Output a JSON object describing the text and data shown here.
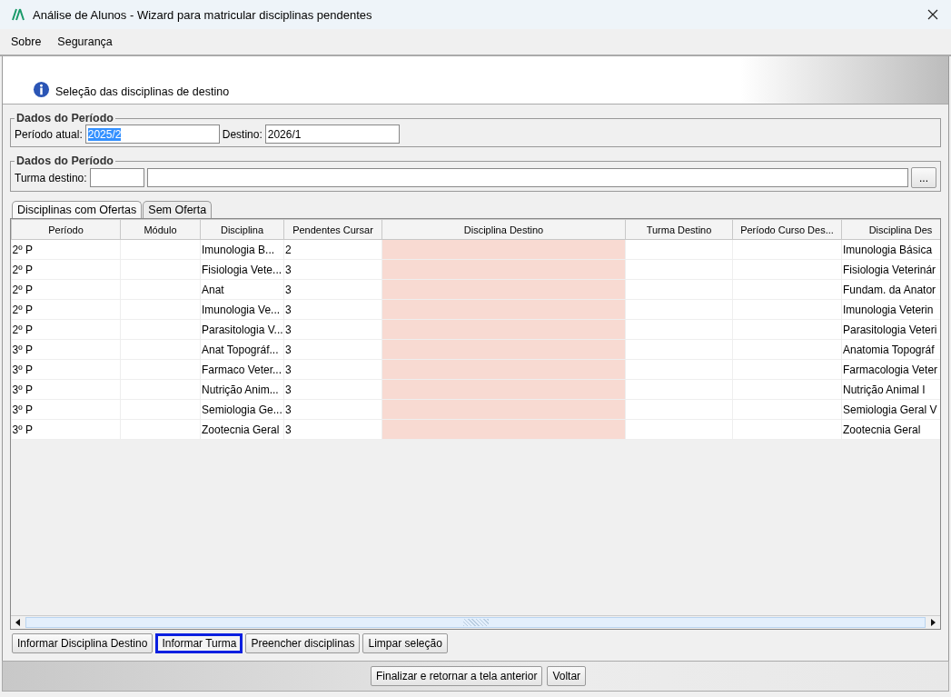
{
  "window": {
    "title": "Análise de Alunos - Wizard para matricular disciplinas pendentes"
  },
  "menu": [
    {
      "label": "Sobre"
    },
    {
      "label": "Segurança"
    }
  ],
  "header": {
    "text": "Seleção das disciplinas de destino"
  },
  "period_group": {
    "legend": "Dados do Período",
    "current_label": "Período atual:",
    "current_value": "2025/2",
    "current_selected": true,
    "target_label": "Destino:",
    "target_value": "2026/1"
  },
  "class_group": {
    "legend": "Dados do Período",
    "label": "Turma destino:",
    "browse": "..."
  },
  "tabs": [
    {
      "label": "Disciplinas com Ofertas",
      "selected": true
    },
    {
      "label": "Sem Oferta",
      "selected": false
    }
  ],
  "table": {
    "columns": [
      {
        "label": "Período",
        "kind": "text"
      },
      {
        "label": "Módulo",
        "kind": "text"
      },
      {
        "label": "Disciplina",
        "kind": "text"
      },
      {
        "label": "Pendentes Cursar",
        "kind": "text"
      },
      {
        "label": "Disciplina Destino",
        "kind": "required"
      },
      {
        "label": "Turma Destino",
        "kind": "text"
      },
      {
        "label": "Período Curso Des...",
        "kind": "text"
      },
      {
        "label": "Disciplina Des",
        "kind": "text"
      }
    ],
    "rows": [
      {
        "cells": [
          "2º P",
          "",
          " Imunologia B...",
          "2",
          "",
          "",
          "",
          "Imunologia Básica"
        ]
      },
      {
        "cells": [
          "2º P",
          "",
          "Fisiologia Vete...",
          "3",
          "",
          "",
          "",
          "Fisiologia Veterinár"
        ]
      },
      {
        "cells": [
          "2º P",
          "",
          "Anat",
          "3",
          "",
          "",
          "",
          "Fundam. da Anator"
        ]
      },
      {
        "cells": [
          "2º P",
          "",
          "Imunologia Ve...",
          "3",
          "",
          "",
          "",
          "Imunologia Veterin"
        ]
      },
      {
        "cells": [
          "2º P",
          "",
          "Parasitologia V...",
          "3",
          "",
          "",
          "",
          "Parasitologia Veteri"
        ]
      },
      {
        "cells": [
          "3º P",
          "",
          "Anat Topográf...",
          "3",
          "",
          "",
          "",
          "Anatomia Topográf"
        ]
      },
      {
        "cells": [
          "3º P",
          "",
          "Farmaco Veter...",
          "3",
          "",
          "",
          "",
          "Farmacologia Veter"
        ]
      },
      {
        "cells": [
          "3º P",
          "",
          "Nutrição Anim...",
          "3",
          "",
          "",
          "",
          "Nutrição Animal I"
        ]
      },
      {
        "cells": [
          "3º P",
          "",
          "Semiologia Ge...",
          "3",
          "",
          "",
          "",
          "Semiologia Geral V"
        ]
      },
      {
        "cells": [
          "3º P",
          "",
          "Zootecnia Geral",
          "3",
          "",
          "",
          "",
          "Zootecnia Geral"
        ]
      }
    ]
  },
  "actions": [
    {
      "label": "Informar Disciplina Destino",
      "focused": false
    },
    {
      "label": "Informar Turma",
      "focused": true
    },
    {
      "label": "Preencher disciplinas",
      "focused": false
    },
    {
      "label": "Limpar seleção",
      "focused": false
    }
  ],
  "footer_buttons": [
    {
      "label": "Finalizar e retornar a tela anterior"
    },
    {
      "label": "Voltar"
    }
  ]
}
